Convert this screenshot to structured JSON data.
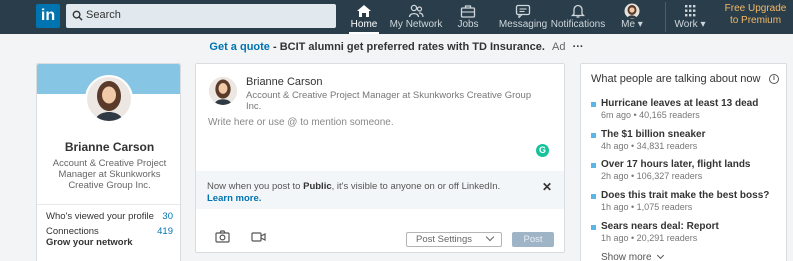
{
  "nav": {
    "search_placeholder": "Search",
    "items": [
      {
        "label": "Home",
        "icon": "home-icon",
        "active": true
      },
      {
        "label": "My Network",
        "icon": "network-icon"
      },
      {
        "label": "Jobs",
        "icon": "briefcase-icon"
      },
      {
        "label": "Messaging",
        "icon": "chat-icon"
      },
      {
        "label": "Notifications",
        "icon": "bell-icon"
      },
      {
        "label": "Me ▾",
        "icon": "avatar-icon"
      },
      {
        "label": "Work ▾",
        "icon": "grid-icon"
      }
    ],
    "upgrade_line1": "Free Upgrade",
    "upgrade_line2": "to Premium"
  },
  "ad": {
    "cta": "Get a quote",
    "text": " - BCIT alumni get preferred rates with TD Insurance.",
    "tag": "Ad",
    "more": "···"
  },
  "profile": {
    "name": "Brianne Carson",
    "headline": "Account & Creative Project Manager at Skunkworks Creative Group Inc.",
    "viewed_label": "Who's viewed your profile",
    "viewed_value": "30",
    "connections_label": "Connections",
    "connections_value": "419",
    "grow_label": "Grow your network"
  },
  "composer": {
    "name": "Brianne Carson",
    "headline": "Account & Creative Project Manager at Skunkworks Creative Group Inc.",
    "placeholder": "Write here or use @ to mention someone.",
    "notice_pre": "Now when you post to ",
    "notice_bold": "Public",
    "notice_post": ", it's visible to anyone on or off LinkedIn. ",
    "notice_link": "Learn more.",
    "post_settings": "Post Settings",
    "post": "Post"
  },
  "news": {
    "title": "What people are talking about now",
    "info": "i",
    "items": [
      {
        "headline": "Hurricane leaves at least 13 dead",
        "meta": "6m ago • 40,165 readers"
      },
      {
        "headline": "The $1 billion sneaker",
        "meta": "4h ago • 34,831 readers"
      },
      {
        "headline": "Over 17 hours later, flight lands",
        "meta": "2h ago • 106,327 readers"
      },
      {
        "headline": "Does this trait make the best boss?",
        "meta": "1h ago • 1,075 readers"
      },
      {
        "headline": "Sears nears deal: Report",
        "meta": "1h ago • 20,291 readers"
      }
    ],
    "show_more": "Show more"
  },
  "colors": {
    "nav_bg": "#293e4a",
    "brand": "#0073b1",
    "premium": "#f5b867",
    "grammarly": "#15c39a"
  }
}
